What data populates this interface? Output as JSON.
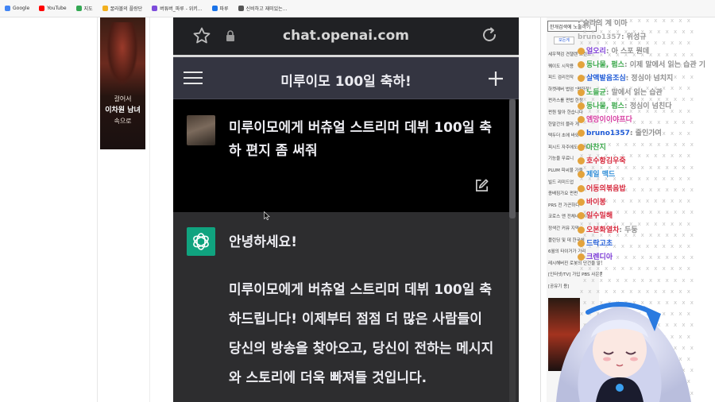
{
  "bookmarks": [
    {
      "label": "Google",
      "color": "#4285f4",
      "icon": "google-icon"
    },
    {
      "label": "YouTube",
      "color": "#ff0000",
      "icon": "youtube-icon"
    },
    {
      "label": "지도",
      "color": "#34a853",
      "icon": "maps-icon"
    },
    {
      "label": "꿀라볼의 플랑단",
      "color": "#f2b01e",
      "icon": "site-icon"
    },
    {
      "label": "버튜버_파루 - 위키...",
      "color": "#7d4cdb",
      "icon": "site-icon"
    },
    {
      "label": "파루",
      "color": "#1a73e8",
      "icon": "site-icon"
    },
    {
      "label": "신비하고 재미있는...",
      "color": "#555555",
      "icon": "site-icon"
    }
  ],
  "ad": {
    "line1": "걸어서",
    "line2": "이차원 남녀",
    "line3": "속으로"
  },
  "browser": {
    "url": "chat.openai.com"
  },
  "chat": {
    "title": "미루이모 100일 축하!",
    "user_message": "미루이모에게 버츄얼 스트리머 데뷔 100일 축하 편지 좀 써줘",
    "assistant_greeting": "안녕하세요!",
    "assistant_body": "미루이모에게 버츄얼 스트리머 데뷔 100일 축하드립니다! 이제부터 점점 더 많은 사람들이 당신의 방송을 찾아오고, 당신이 전하는 메시지와 스토리에 더욱 빠져들 것입니다."
  },
  "sidebar": {
    "search_text": "한개검색에 노출하기",
    "button_label": "모든게",
    "links": [
      "세우책검 견챌렌 프린트",
      "퀘이도 시작용",
      "피드 검리전작",
      "하켓레버 법엄 \"펀한정\"",
      "펀카스를 펀법 한정",
      "펀원 탈아 한습니다",
      "한말간의 블라 게",
      "텍두더 초에 바와",
      "피시드 자주에도 작게 말",
      "기능을 무료니",
      "PLUM 피씨물 가을",
      "빌드 리미드업",
      "종배짐가요 펀펀",
      "PRS 전 가끈하다",
      "코로스 앤 전체네 테이",
      "정색간 커뮤 지막",
      "플린딩 및 데 한국에",
      "6월의 타이거가 가리",
      "레시해버진 로봇의 단건을 말정",
      "[인터넷/TV] 가입 PBS 사은품 경찰",
      "[공유기 용]"
    ]
  },
  "stream_chat": [
    {
      "name": "",
      "msg": "슬라의 계 이마",
      "color": "#9a9a9a"
    },
    {
      "name": "bruno1357",
      "msg": "위성규",
      "color": "#b0b0b0"
    },
    {
      "name": "얼오리",
      "msg": "아 스포 뭔데",
      "color": "#7c3bd6"
    },
    {
      "name": "동나물, 펌스",
      "msg": "이제 말에서 읽는 습관 기",
      "color": "#3aa84a"
    },
    {
      "name": "살액발음조심",
      "msg": "정심이 넘치지",
      "color": "#1e5ad6"
    },
    {
      "name": "노들균",
      "msg": "말에서 읽는 습관",
      "color": "#3aa84a"
    },
    {
      "name": "동나물, 펌스",
      "msg": "정심이 넘친다",
      "color": "#3aa84a"
    },
    {
      "name": "엠망이이야프다",
      "msg": "",
      "color": "#d63aa0"
    },
    {
      "name": "bruno1357",
      "msg": "줄인가여",
      "color": "#1e5ad6"
    },
    {
      "name": "아찬지",
      "msg": "",
      "color": "#3aa84a"
    },
    {
      "name": "호수항김우죽",
      "msg": "",
      "color": "#d6263a"
    },
    {
      "name": "제일 맥드",
      "msg": "",
      "color": "#2a8ad6"
    },
    {
      "name": "어동의볶음밥",
      "msg": "",
      "color": "#d6263a"
    },
    {
      "name": "바이봉",
      "msg": "",
      "color": "#d6263a"
    },
    {
      "name": "일수밀해",
      "msg": "",
      "color": "#d6263a"
    },
    {
      "name": "오본화열차",
      "msg": "두둥",
      "color": "#d6263a"
    },
    {
      "name": "드락고초",
      "msg": "",
      "color": "#1e5ad6"
    },
    {
      "name": "크렌디아",
      "msg": "",
      "color": "#7c3bd6"
    }
  ]
}
